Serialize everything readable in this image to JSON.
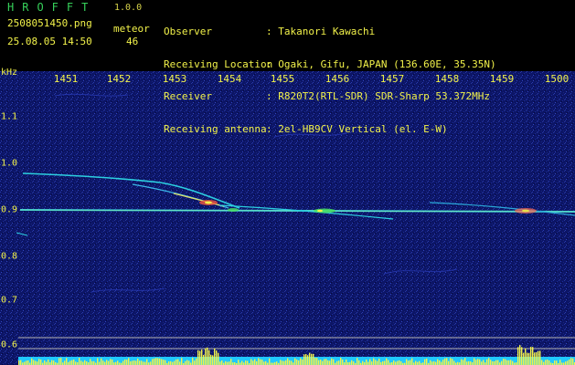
{
  "app": {
    "title": "HROFFT",
    "version": "1.0.0"
  },
  "file": {
    "name": "2508051450.png",
    "datetime": "25.08.05 14:50"
  },
  "meteor": {
    "label": "meteor",
    "count": "46"
  },
  "info": [
    {
      "key": "Observer",
      "value": ": Takanori Kawachi"
    },
    {
      "key": "Receiving Location",
      "value": ": Ogaki, Gifu, JAPAN (136.60E, 35.35N)"
    },
    {
      "key": "Receiver",
      "value": ": R820T2(RTL-SDR) SDR-Sharp 53.372MHz"
    },
    {
      "key": "Receiving antenna",
      "value": ": 2el-HB9CV Vertical (el. E-W)"
    }
  ],
  "axis": {
    "y_unit": "kHz",
    "x_ticks": [
      "1451",
      "1452",
      "1453",
      "1454",
      "1455",
      "1456",
      "1457",
      "1458",
      "1459",
      "1500"
    ],
    "y_ticks": [
      "1.1",
      "1.0",
      "0.9",
      "0.8",
      "0.7",
      "0.6"
    ]
  },
  "colors": {
    "text": "#f2f24a",
    "title": "#36d05a",
    "background": "#0b1466"
  }
}
